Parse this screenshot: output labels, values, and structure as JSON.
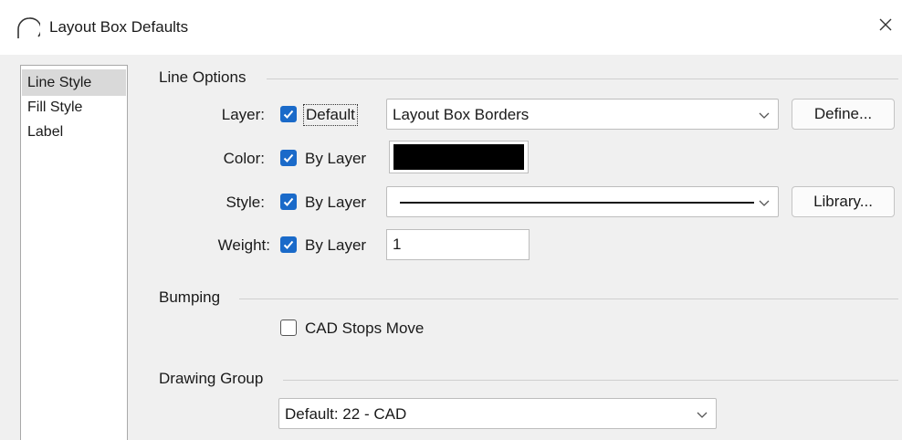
{
  "window": {
    "title": "Layout Box Defaults"
  },
  "sidebar": {
    "items": [
      {
        "label": "Line Style",
        "selected": true
      },
      {
        "label": "Fill Style",
        "selected": false
      },
      {
        "label": "Label",
        "selected": false
      }
    ]
  },
  "line_options": {
    "group_title": "Line Options",
    "layer": {
      "label": "Layer:",
      "checkbox_label": "Default",
      "checked": true,
      "value": "Layout Box Borders",
      "button_label": "Define..."
    },
    "color": {
      "label": "Color:",
      "checkbox_label": "By Layer",
      "checked": true,
      "swatch_color": "#000000"
    },
    "style": {
      "label": "Style:",
      "checkbox_label": "By Layer",
      "checked": true,
      "button_label": "Library..."
    },
    "weight": {
      "label": "Weight:",
      "checkbox_label": "By Layer",
      "checked": true,
      "value": "1"
    }
  },
  "bumping": {
    "group_title": "Bumping",
    "cad_stops_move": {
      "label": "CAD Stops Move",
      "checked": false
    }
  },
  "drawing_group": {
    "group_title": "Drawing Group",
    "value": "Default: 22 - CAD"
  },
  "colors": {
    "checkbox_accent": "#1a6ac9",
    "sidebar_selected": "#d9d9d9"
  }
}
